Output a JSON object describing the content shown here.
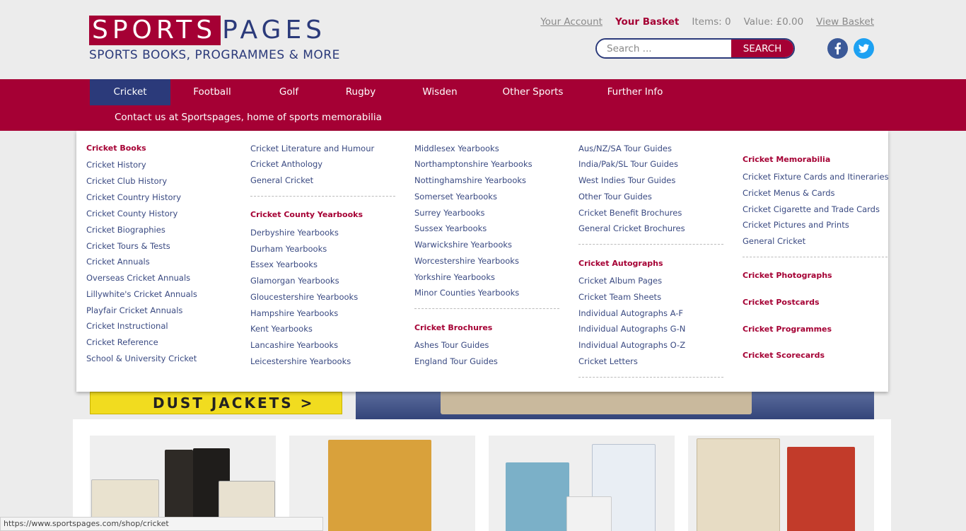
{
  "logo": {
    "sports": "SPORTS",
    "pages": "PAGES",
    "tagline": "SPORTS BOOKS, PROGRAMMES & MORE"
  },
  "top_links": {
    "account": "Your Account",
    "basket": "Your Basket",
    "items": "Items: 0",
    "value": "Value: £0.00",
    "view_basket": "View Basket"
  },
  "search": {
    "placeholder": "Search ...",
    "button": "SEARCH"
  },
  "social": {
    "facebook_icon": "facebook-icon",
    "twitter_icon": "twitter-icon"
  },
  "nav": {
    "items": [
      "Cricket",
      "Football",
      "Golf",
      "Rugby",
      "Wisden",
      "Other Sports",
      "Further Info"
    ],
    "active": "Cricket",
    "contact": "Contact us at Sportspages, home of sports memorabilia"
  },
  "mega_menu": {
    "col1": {
      "heading": "Cricket Books",
      "items": [
        "Cricket History",
        "Cricket Club History",
        "Cricket Country History",
        "Cricket County History",
        "Cricket Biographies",
        "Cricket Tours & Tests",
        "Cricket Annuals",
        "Overseas Cricket Annuals",
        "Lillywhite's Cricket Annuals",
        "Playfair Cricket Annuals",
        "Cricket Instructional",
        "Cricket Reference",
        "School & University Cricket"
      ]
    },
    "col2": {
      "items_top": [
        "Cricket Literature and Humour",
        "Cricket Anthology",
        "General Cricket"
      ],
      "heading": "Cricket County Yearbooks",
      "items": [
        "Derbyshire Yearbooks",
        "Durham Yearbooks",
        "Essex Yearbooks",
        "Glamorgan Yearbooks",
        "Gloucestershire Yearbooks",
        "Hampshire Yearbooks",
        "Kent Yearbooks",
        "Lancashire Yearbooks",
        "Leicestershire Yearbooks"
      ]
    },
    "col3": {
      "items_top": [
        "Middlesex Yearbooks",
        "Northamptonshire Yearbooks",
        "Nottinghamshire Yearbooks",
        "Somerset Yearbooks",
        "Surrey Yearbooks",
        "Sussex Yearbooks",
        "Warwickshire Yearbooks",
        "Worcestershire Yearbooks",
        "Yorkshire Yearbooks",
        "Minor Counties Yearbooks"
      ],
      "heading": "Cricket Brochures",
      "items": [
        "Ashes Tour Guides",
        "England Tour Guides"
      ]
    },
    "col4": {
      "items_top": [
        "Aus/NZ/SA Tour Guides",
        "India/Pak/SL Tour Guides",
        "West Indies Tour Guides",
        "Other Tour Guides",
        "Cricket Benefit Brochures",
        "General Cricket Brochures"
      ],
      "heading": "Cricket Autographs",
      "items": [
        "Cricket Album Pages",
        "Cricket Team Sheets",
        "Individual Autographs A-F",
        "Individual Autographs G-N",
        "Individual Autographs O-Z",
        "Cricket Letters"
      ]
    },
    "col5": {
      "heading": "Cricket Memorabilia",
      "items": [
        "Cricket Fixture Cards and Itineraries",
        "Cricket Menus & Cards",
        "Cricket Cigarette and Trade Cards",
        "Cricket Pictures and Prints",
        "General Cricket"
      ],
      "headings_bottom": [
        "Cricket Photographs",
        "Cricket Postcards",
        "Cricket Programmes",
        "Cricket Scorecards"
      ]
    }
  },
  "banner": {
    "dust_jackets": "DUST JACKETS >"
  },
  "status_url": "https://www.sportspages.com/shop/cricket",
  "colors": {
    "brand_red": "#a50034",
    "brand_navy": "#2b3a7a"
  }
}
